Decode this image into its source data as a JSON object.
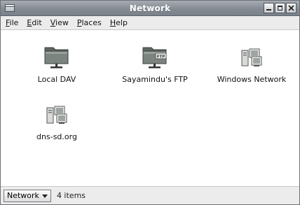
{
  "window": {
    "title": "Network"
  },
  "menubar": {
    "items": [
      {
        "key": "F",
        "rest": "ile"
      },
      {
        "key": "E",
        "rest": "dit"
      },
      {
        "key": "V",
        "rest": "iew"
      },
      {
        "key": "P",
        "rest": "laces"
      },
      {
        "key": "H",
        "rest": "elp"
      }
    ]
  },
  "content": {
    "items": [
      {
        "label": "Local DAV",
        "icon": "network-folder-icon"
      },
      {
        "label": "Sayamindu's FTP",
        "icon": "ftp-folder-icon",
        "badge": "FTP"
      },
      {
        "label": "Windows Network",
        "icon": "network-computers-icon"
      },
      {
        "label": "dns-sd.org",
        "icon": "network-computers-icon"
      }
    ]
  },
  "statusbar": {
    "location": "Network",
    "count": "4 items"
  },
  "colors": {
    "titlebar": "#858b93",
    "folder": "#6f7772"
  }
}
